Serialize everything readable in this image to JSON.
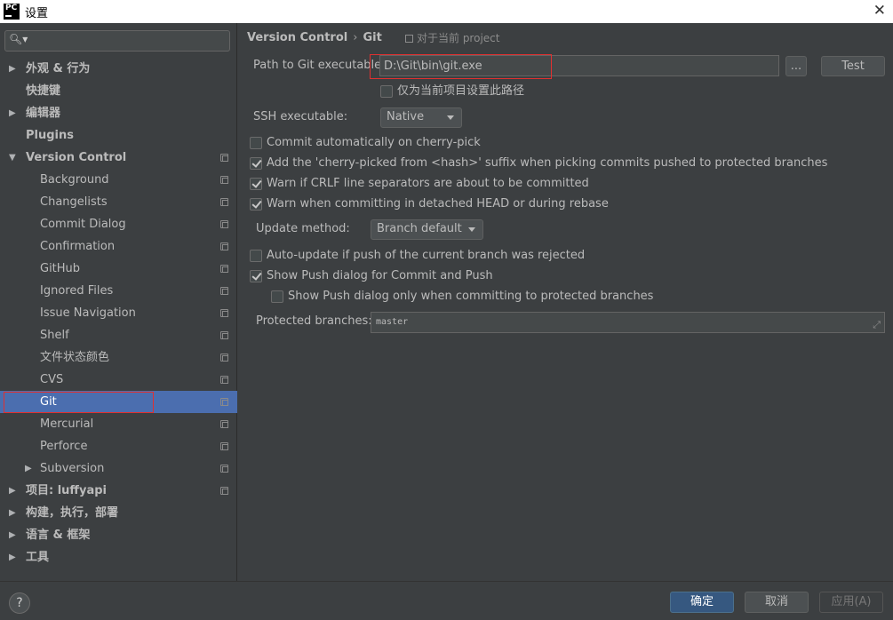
{
  "window": {
    "app_icon": "PC",
    "title": "设置"
  },
  "sidebar": {
    "search": {
      "value": "",
      "placeholder": ""
    },
    "items": [
      {
        "label": "外观 & 行为"
      },
      {
        "label": "快捷键"
      },
      {
        "label": "编辑器"
      },
      {
        "label": "Plugins"
      },
      {
        "label": "Version Control"
      },
      {
        "label": "Background"
      },
      {
        "label": "Changelists"
      },
      {
        "label": "Commit Dialog"
      },
      {
        "label": "Confirmation"
      },
      {
        "label": "GitHub"
      },
      {
        "label": "Ignored Files"
      },
      {
        "label": "Issue Navigation"
      },
      {
        "label": "Shelf"
      },
      {
        "label": "文件状态颜色"
      },
      {
        "label": "CVS"
      },
      {
        "label": "Git"
      },
      {
        "label": "Mercurial"
      },
      {
        "label": "Perforce"
      },
      {
        "label": "Subversion"
      },
      {
        "label": "项目: luffyapi"
      },
      {
        "label": "构建，执行，部署"
      },
      {
        "label": "语言 & 框架"
      },
      {
        "label": "工具"
      }
    ]
  },
  "main": {
    "breadcrumb": {
      "parent": "Version Control",
      "separator": "›",
      "current": "Git"
    },
    "scope_note": "对于当前 project",
    "git_path": {
      "label": "Path to Git executable:",
      "value": "D:\\Git\\bin\\git.exe",
      "browse_label": "...",
      "test_label": "Test"
    },
    "current_project_only": {
      "label": "仅为当前项目设置此路径",
      "checked": false
    },
    "ssh": {
      "label": "SSH executable:",
      "value": "Native"
    },
    "options": [
      {
        "label": "Commit automatically on cherry-pick",
        "checked": false
      },
      {
        "label": "Add the 'cherry-picked from <hash>' suffix when picking commits pushed to protected branches",
        "checked": true
      },
      {
        "label": "Warn if CRLF line separators are about to be committed",
        "checked": true
      },
      {
        "label": "Warn when committing in detached HEAD or during rebase",
        "checked": true
      }
    ],
    "update_method": {
      "label": "Update method:",
      "value": "Branch default"
    },
    "options2": [
      {
        "label": "Auto-update if push of the current branch was rejected",
        "checked": false
      },
      {
        "label": "Show Push dialog for Commit and Push",
        "checked": true
      },
      {
        "label": "Show Push dialog only when committing to protected branches",
        "checked": false
      }
    ],
    "protected_branches": {
      "label": "Protected branches:",
      "value": "master"
    }
  },
  "footer": {
    "help_label": "?",
    "ok_label": "确定",
    "cancel_label": "取消",
    "apply_label": "应用(A)"
  }
}
